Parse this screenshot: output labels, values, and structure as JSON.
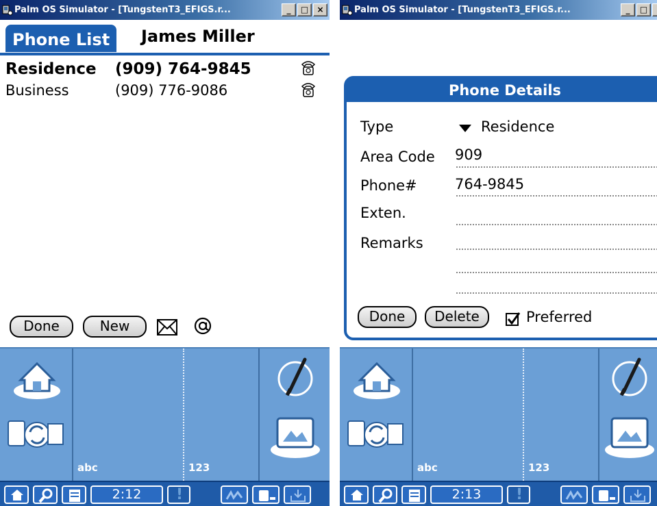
{
  "windows": [
    {
      "title": "Palm OS Simulator - [TungstenT3_EFIGS.r...",
      "title_buttons": [
        "_",
        "□",
        "×"
      ],
      "app": {
        "tab_title": "Phone List",
        "record_name": "James Miller",
        "phones": [
          {
            "type": "Residence",
            "number": "(909) 764-9845",
            "selected": true,
            "icon": "phone-icon"
          },
          {
            "type": "Business",
            "number": "(909) 776-9086",
            "selected": false,
            "icon": "phone-icon"
          }
        ],
        "buttons": {
          "done": "Done",
          "new": "New"
        },
        "icons": [
          "envelope-icon",
          "at-sign-icon"
        ]
      },
      "graffiti": {
        "abc_label": "abc",
        "num_label": "123"
      },
      "statusbar": {
        "time": "2:12"
      }
    },
    {
      "title": "Palm OS Simulator - [TungstenT3_EFIGS.r...",
      "title_buttons": [
        "_",
        "□",
        "×"
      ],
      "dialog": {
        "title": "Phone Details",
        "type_label": "Type",
        "type_value": "Residence",
        "area_label": "Area Code",
        "area_value": "909",
        "phone_label": "Phone#",
        "phone_value": "764-9845",
        "ext_label": "Exten.",
        "ext_value": "",
        "remarks_label": "Remarks",
        "remarks_value": "",
        "buttons": {
          "done": "Done",
          "delete": "Delete"
        },
        "preferred_label": "Preferred",
        "preferred_checked": true
      },
      "graffiti": {
        "abc_label": "abc",
        "num_label": "123"
      },
      "statusbar": {
        "time": "2:13"
      }
    }
  ],
  "colors": {
    "palm_blue": "#1c5fb0",
    "graffiti_blue": "#6b9fd6",
    "titlebar_dark": "#0a246a"
  }
}
